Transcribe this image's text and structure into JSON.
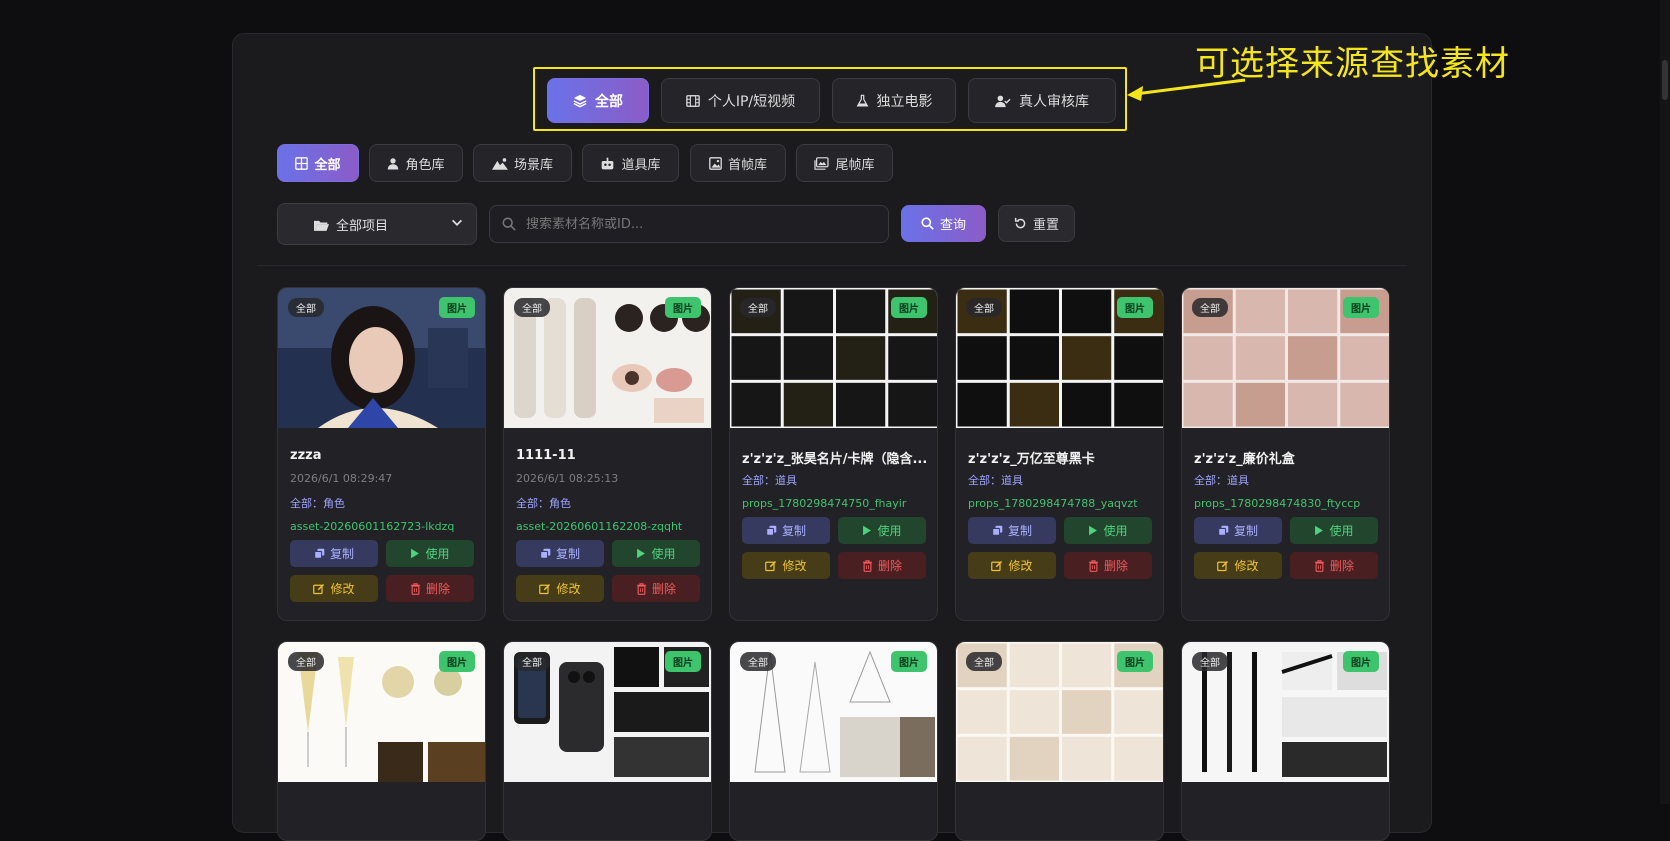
{
  "annotation": "可选择来源查找素材",
  "sources": [
    {
      "label": "全部",
      "icon": "layers-icon",
      "active": true
    },
    {
      "label": "个人IP/短视频",
      "icon": "film-icon",
      "active": false
    },
    {
      "label": "独立电影",
      "icon": "flask-icon",
      "active": false
    },
    {
      "label": "真人审核库",
      "icon": "user-check-icon",
      "active": false
    }
  ],
  "categories": [
    {
      "label": "全部",
      "icon": "grid-icon",
      "active": true
    },
    {
      "label": "角色库",
      "icon": "user-icon",
      "active": false
    },
    {
      "label": "场景库",
      "icon": "mountain-icon",
      "active": false
    },
    {
      "label": "道具库",
      "icon": "robot-icon",
      "active": false
    },
    {
      "label": "首帧库",
      "icon": "image-icon",
      "active": false
    },
    {
      "label": "尾帧库",
      "icon": "images-icon",
      "active": false
    }
  ],
  "filter": {
    "project_select": "全部项目",
    "search_placeholder": "搜索素材名称或ID...",
    "query_label": "查询",
    "reset_label": "重置"
  },
  "cards": [
    {
      "source": "全部",
      "type": "图片",
      "title": "zzza",
      "date": "2026/6/1 08:29:47",
      "category": "全部：角色",
      "id": "asset-20260601162723-lkdzq",
      "theme": "portrait"
    },
    {
      "source": "全部",
      "type": "图片",
      "title": "1111-11",
      "date": "2026/6/1 08:25:13",
      "category": "全部：角色",
      "id": "asset-20260601162208-zqqht",
      "theme": "fashion"
    },
    {
      "source": "全部",
      "type": "图片",
      "title": "z'z'z'z_张昊名片/卡牌（隐含...",
      "date": "",
      "category": "全部：道具",
      "id": "props_1780298474750_fhayir",
      "theme": "cards-black"
    },
    {
      "source": "全部",
      "type": "图片",
      "title": "z'z'z'z_万亿至尊黑卡",
      "date": "",
      "category": "全部：道具",
      "id": "props_1780298474788_yaqvzt",
      "theme": "cards-gold"
    },
    {
      "source": "全部",
      "type": "图片",
      "title": "z'z'z'z_廉价礼盒",
      "date": "",
      "category": "全部：道具",
      "id": "props_1780298474830_ftyccp",
      "theme": "giftbox"
    },
    {
      "source": "全部",
      "type": "图片",
      "theme": "champagne"
    },
    {
      "source": "全部",
      "type": "图片",
      "theme": "phone"
    },
    {
      "source": "全部",
      "type": "图片",
      "theme": "tower"
    },
    {
      "source": "全部",
      "type": "图片",
      "theme": "gloves"
    },
    {
      "source": "全部",
      "type": "图片",
      "theme": "pens"
    }
  ],
  "actions": {
    "copy": "复制",
    "use": "使用",
    "edit": "修改",
    "delete": "删除"
  }
}
